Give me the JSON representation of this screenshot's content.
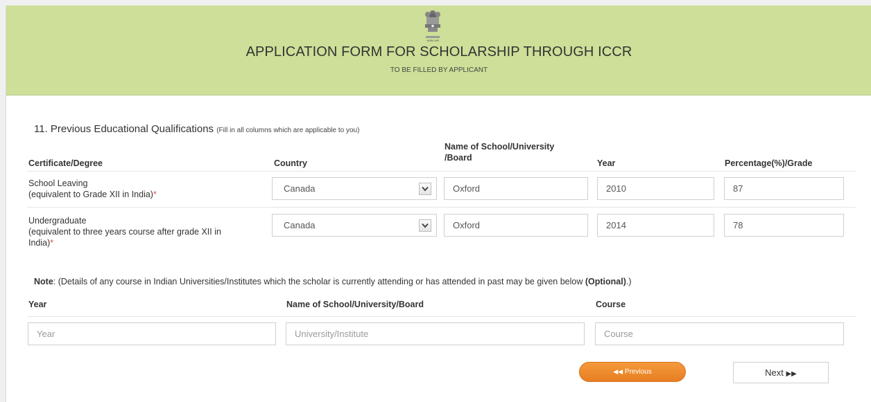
{
  "header": {
    "emblem_caption": "सत्यमेव जयते",
    "title": "APPLICATION FORM FOR SCHOLARSHIP THROUGH ICCR",
    "subtitle": "TO BE FILLED BY APPLICANT"
  },
  "section": {
    "title": "11. Previous Educational Qualifications",
    "hint": "(Fill in all columns which are applicable to you)"
  },
  "qualifications": {
    "headers": {
      "certificate": "Certificate/Degree",
      "country": "Country",
      "school_line1": "Name of School/University",
      "school_line2": "/Board",
      "year": "Year",
      "percentage": "Percentage(%)/Grade"
    },
    "rows": [
      {
        "label_line1": "School Leaving",
        "label_line2": "(equivalent to Grade XII in India)",
        "required_mark": "*",
        "country": "Canada",
        "school": "Oxford",
        "year": "2010",
        "percentage": "87"
      },
      {
        "label_line1": "Undergraduate",
        "label_line2": "(equivalent to three years course after grade XII in",
        "label_line3": "India)",
        "required_mark": "*",
        "country": "Canada",
        "school": "Oxford",
        "year": "2014",
        "percentage": "78"
      }
    ]
  },
  "note": {
    "prefix": "Note",
    "text": ": (Details of any course in Indian Universities/Institutes which the scholar is currently attending or has attended in past may be given below ",
    "optional": "(Optional)",
    "suffix": ".)"
  },
  "indian_courses": {
    "headers": {
      "year": "Year",
      "school": "Name of School/University/Board",
      "course": "Course"
    },
    "placeholders": {
      "year": "Year",
      "school": "University/Institute",
      "course": "Course"
    }
  },
  "buttons": {
    "previous": "Previous",
    "next": "Next"
  },
  "colors": {
    "header_bg": "#cddf98",
    "previous_button": "#f0903a",
    "required": "#d9534f"
  }
}
